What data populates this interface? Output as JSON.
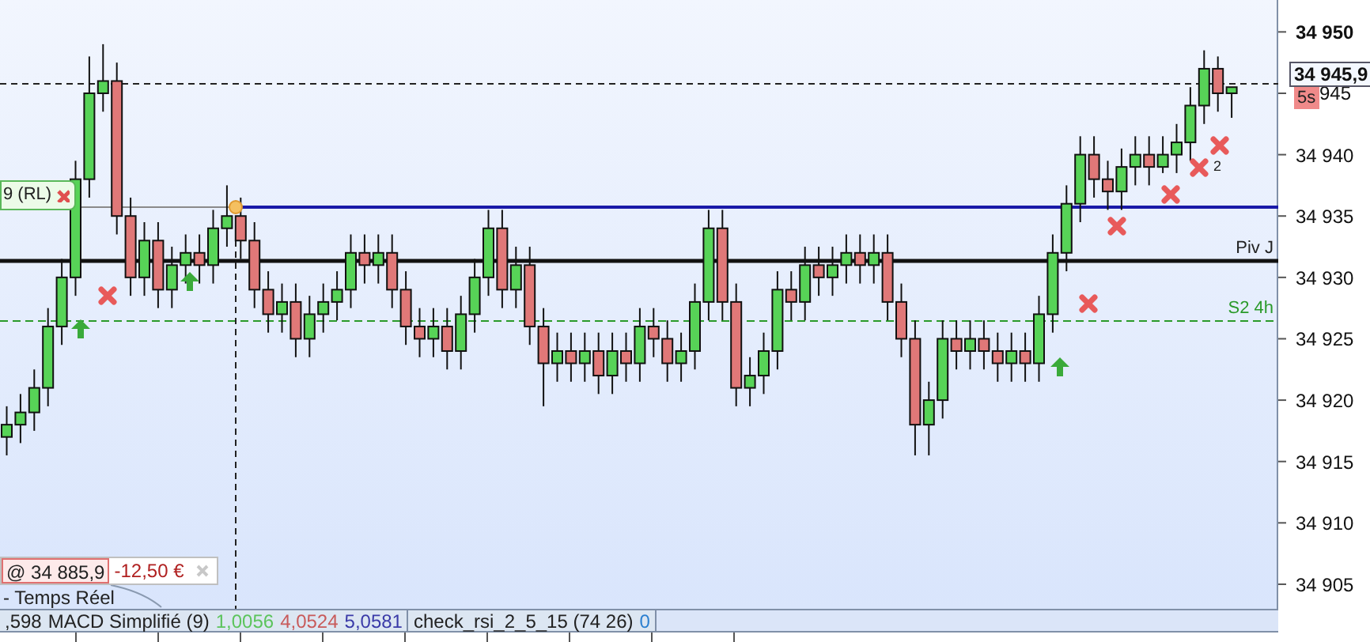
{
  "chart_data": {
    "type": "candlestick",
    "ylim": [
      34903,
      34952.6
    ],
    "yticks": [
      {
        "value": 34950,
        "label": "34 950"
      },
      {
        "value": 34940,
        "label": "34 940"
      },
      {
        "value": 34935,
        "label": "34 935"
      },
      {
        "value": 34930,
        "label": "34 930"
      },
      {
        "value": 34925,
        "label": "34 925"
      },
      {
        "value": 34920,
        "label": "34 920"
      },
      {
        "value": 34915,
        "label": "34 915"
      },
      {
        "value": 34910,
        "label": "34 910"
      },
      {
        "value": 34905,
        "label": "34 905"
      }
    ],
    "ohlc": [
      [
        34917,
        34919.5,
        34915.5,
        34918
      ],
      [
        34918,
        34920.5,
        34916.5,
        34919
      ],
      [
        34919,
        34922.5,
        34917.5,
        34921
      ],
      [
        34921,
        34927.5,
        34919.5,
        34926
      ],
      [
        34926,
        34931.5,
        34924.5,
        34930
      ],
      [
        34930,
        34939.5,
        34928.5,
        34938
      ],
      [
        34938,
        34948,
        34936.5,
        34945
      ],
      [
        34945,
        34949,
        34943.5,
        34946
      ],
      [
        34946,
        34947.5,
        34933.5,
        34935
      ],
      [
        34935,
        34936.5,
        34928.5,
        34930
      ],
      [
        34930,
        34934.5,
        34928.5,
        34933
      ],
      [
        34933,
        34934.5,
        34927.5,
        34929
      ],
      [
        34929,
        34932.5,
        34927.5,
        34931
      ],
      [
        34931,
        34933.5,
        34929.5,
        34932
      ],
      [
        34932,
        34933.5,
        34929.5,
        34931
      ],
      [
        34931,
        34935.5,
        34929.5,
        34934
      ],
      [
        34934,
        34937.5,
        34932.5,
        34935
      ],
      [
        34935,
        34936.5,
        34931.5,
        34933
      ],
      [
        34933,
        34934.5,
        34927.5,
        34929
      ],
      [
        34929,
        34930.5,
        34925.5,
        34927
      ],
      [
        34927,
        34929.5,
        34925.5,
        34928
      ],
      [
        34928,
        34929.5,
        34923.5,
        34925
      ],
      [
        34925,
        34928.5,
        34923.5,
        34927
      ],
      [
        34927,
        34929.5,
        34925.5,
        34928
      ],
      [
        34928,
        34930.5,
        34926.5,
        34929
      ],
      [
        34929,
        34933.5,
        34927.5,
        34932
      ],
      [
        34932,
        34933.5,
        34929.5,
        34931
      ],
      [
        34931,
        34933.5,
        34929.5,
        34932
      ],
      [
        34932,
        34933.5,
        34927.5,
        34929
      ],
      [
        34929,
        34930.5,
        34924.5,
        34926
      ],
      [
        34926,
        34927.5,
        34923.5,
        34925
      ],
      [
        34925,
        34927.5,
        34923.5,
        34926
      ],
      [
        34926,
        34927.5,
        34922.5,
        34924
      ],
      [
        34924,
        34928.5,
        34922.5,
        34927
      ],
      [
        34927,
        34931.5,
        34925.5,
        34930
      ],
      [
        34930,
        34935.5,
        34928.5,
        34934
      ],
      [
        34934,
        34935.5,
        34927.5,
        34929
      ],
      [
        34929,
        34932.5,
        34927.5,
        34931
      ],
      [
        34931,
        34932.5,
        34924.5,
        34926
      ],
      [
        34926,
        34927.5,
        34919.5,
        34923
      ],
      [
        34923,
        34925.5,
        34921.5,
        34924
      ],
      [
        34924,
        34925.5,
        34921.5,
        34923
      ],
      [
        34923,
        34925.5,
        34921.5,
        34924
      ],
      [
        34924,
        34925.5,
        34920.5,
        34922
      ],
      [
        34922,
        34925.5,
        34920.5,
        34924
      ],
      [
        34924,
        34925.5,
        34921.5,
        34923
      ],
      [
        34923,
        34927.5,
        34921.5,
        34926
      ],
      [
        34926,
        34927.5,
        34923.5,
        34925
      ],
      [
        34925,
        34926.5,
        34921.5,
        34923
      ],
      [
        34923,
        34925.5,
        34921.5,
        34924
      ],
      [
        34924,
        34929.5,
        34922.5,
        34928
      ],
      [
        34928,
        34935.5,
        34926.5,
        34934
      ],
      [
        34934,
        34935.5,
        34926.5,
        34928
      ],
      [
        34928,
        34929.5,
        34919.5,
        34921
      ],
      [
        34921,
        34923.5,
        34919.5,
        34922
      ],
      [
        34922,
        34925.5,
        34920.5,
        34924
      ],
      [
        34924,
        34930.5,
        34922.5,
        34929
      ],
      [
        34929,
        34930.5,
        34926.5,
        34928
      ],
      [
        34928,
        34932.5,
        34926.5,
        34931
      ],
      [
        34931,
        34932.5,
        34928.5,
        34930
      ],
      [
        34930,
        34932.5,
        34928.5,
        34931
      ],
      [
        34931,
        34933.5,
        34929.5,
        34932
      ],
      [
        34932,
        34933.5,
        34929.5,
        34931
      ],
      [
        34931,
        34933.5,
        34929.5,
        34932
      ],
      [
        34932,
        34933.5,
        34926.5,
        34928
      ],
      [
        34928,
        34929.5,
        34923.5,
        34925
      ],
      [
        34925,
        34926.5,
        34915.5,
        34918
      ],
      [
        34918,
        34921.5,
        34915.5,
        34920
      ],
      [
        34920,
        34926.5,
        34918.5,
        34925
      ],
      [
        34925,
        34926.5,
        34922.5,
        34924
      ],
      [
        34924,
        34926.5,
        34922.5,
        34925
      ],
      [
        34925,
        34926.5,
        34922.5,
        34924
      ],
      [
        34924,
        34925.5,
        34921.5,
        34923
      ],
      [
        34923,
        34925.5,
        34921.5,
        34924
      ],
      [
        34924,
        34925.5,
        34921.5,
        34923
      ],
      [
        34923,
        34928.5,
        34921.5,
        34927
      ],
      [
        34927,
        34933.5,
        34925.5,
        34932
      ],
      [
        34932,
        34937.5,
        34930.5,
        34936
      ],
      [
        34936,
        34941.5,
        34934.5,
        34940
      ],
      [
        34940,
        34941.5,
        34936.5,
        34938
      ],
      [
        34938,
        34939.5,
        34935.5,
        34937
      ],
      [
        34937,
        34940.5,
        34935.5,
        34939
      ],
      [
        34939,
        34941.5,
        34937.5,
        34940
      ],
      [
        34940,
        34941.5,
        34937.5,
        34939
      ],
      [
        34939,
        34941.5,
        34938.5,
        34940
      ],
      [
        34940,
        34942.5,
        34938.5,
        34941
      ],
      [
        34941,
        34945.5,
        34939.5,
        34944
      ],
      [
        34944,
        34948.5,
        34942.5,
        34947
      ],
      [
        34947,
        34948,
        34943.5,
        34945
      ],
      [
        34945,
        34945.5,
        34943,
        34945.5
      ]
    ]
  },
  "current_price": {
    "value": "34 945,9",
    "timer": "5s",
    "axis_label_behind": "945"
  },
  "levels": [
    {
      "label": "Piv J",
      "kind": "pivot"
    },
    {
      "label": "S2 4h",
      "kind": "support"
    }
  ],
  "position_tag": {
    "label": "9 (RL)"
  },
  "order_tag": {
    "price": "@ 34 885,9",
    "pnl": "-12,50 €"
  },
  "feed_label": "- Temps Réel",
  "signal_count": "2",
  "indicator_bar": [
    {
      "kind": "panel",
      "items": [
        {
          "text": ",598",
          "color": "#222222"
        },
        {
          "text": "MACD Simplifié (9)",
          "color": "#222222"
        },
        {
          "text": "1,0056",
          "color": "#5cc45c"
        },
        {
          "text": "4,0524",
          "color": "#c85a5a"
        },
        {
          "text": "5,0581",
          "color": "#3a3aa8"
        }
      ]
    },
    {
      "kind": "panel",
      "items": [
        {
          "text": "check_rsi_2_5_15 (74 26)",
          "color": "#222222"
        },
        {
          "text": "0",
          "color": "#2a7fd0"
        }
      ]
    }
  ]
}
